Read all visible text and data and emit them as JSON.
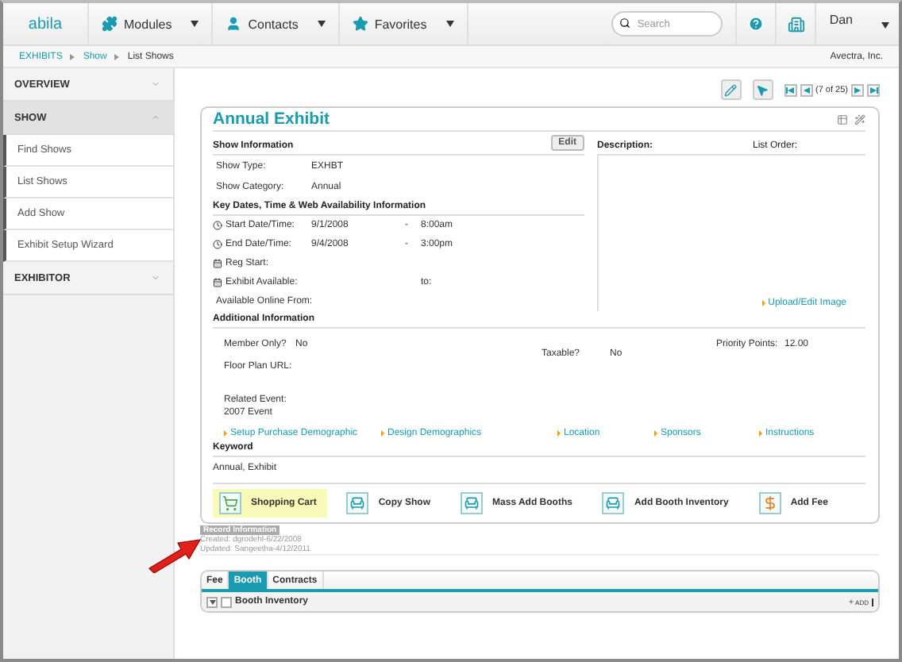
{
  "nav": {
    "logo": "abila",
    "menus": [
      {
        "kind": "modules",
        "label": "Modules"
      },
      {
        "kind": "contacts",
        "label": "Contacts"
      },
      {
        "kind": "favorites",
        "label": "Favorites"
      }
    ],
    "search": {
      "placeholder": "Search"
    },
    "user": "Dan"
  },
  "breadcrumb": {
    "items": [
      "EXHIBITS",
      "Show",
      "List Shows"
    ],
    "organization": "Avectra, Inc."
  },
  "sidebar": {
    "sections": [
      {
        "label": "OVERVIEW",
        "expanded": false
      },
      {
        "label": "SHOW",
        "expanded": true,
        "items": [
          "Find Shows",
          "List Shows",
          "Add Show",
          "Exhibit Setup Wizard"
        ]
      },
      {
        "label": "EXHIBITOR",
        "expanded": false
      }
    ]
  },
  "pager": {
    "position": "(7 of 25)"
  },
  "card": {
    "title": "Annual Exhibit",
    "show_information": {
      "heading": "Show Information",
      "edit_button": "Edit",
      "fields": [
        {
          "label": "Show Type:",
          "value": "EXHBT"
        },
        {
          "label": "Show Category:",
          "value": "Annual"
        }
      ]
    },
    "key_dates": {
      "heading": "Key Dates, Time & Web Availability Information",
      "rows": [
        {
          "kind": "time",
          "label": "Start Date/Time:",
          "date": "9/1/2008",
          "separator": "-",
          "time": "8:00am"
        },
        {
          "kind": "time",
          "label": "End Date/Time:",
          "date": "9/4/2008",
          "separator": "-",
          "time": "3:00pm"
        },
        {
          "kind": "date",
          "label": "Reg Start:"
        },
        {
          "kind": "date",
          "label": "Exhibit Available:",
          "to": "to:"
        },
        {
          "kind": "online",
          "label": "Available Online From:"
        }
      ]
    },
    "description": {
      "label": "Description:",
      "list_order": "List Order:",
      "upload_link": "Upload/Edit Image"
    },
    "additional": {
      "heading": "Additional Information",
      "member_only": {
        "label": "Member Only?",
        "value": "No"
      },
      "taxable": {
        "label": "Taxable?",
        "value": "No"
      },
      "priority_points": {
        "label": "Priority Points:",
        "value": "12.00"
      },
      "floor_plan_url": {
        "label": "Floor Plan URL:"
      },
      "related_event": {
        "label": "Related Event:",
        "value": "2007 Event"
      }
    },
    "links": [
      "Setup Purchase Demographic",
      "Design Demographics",
      "Location",
      "Sponsors",
      "Instructions"
    ],
    "keyword": {
      "heading": "Keyword",
      "value": "Annual, Exhibit"
    },
    "actions": [
      {
        "kind": "cart",
        "label": "Shopping Cart",
        "highlighted": true
      },
      {
        "kind": "booth",
        "label": "Copy Show",
        "highlighted": false
      },
      {
        "kind": "booth",
        "label": "Mass Add Booths",
        "highlighted": false
      },
      {
        "kind": "booth",
        "label": "Add Booth Inventory",
        "highlighted": false
      },
      {
        "kind": "fee",
        "label": "Add Fee",
        "highlighted": false
      }
    ]
  },
  "record_information": {
    "heading": "Record Information",
    "created": "Created: dgrodehl-6/22/2008",
    "updated": "Updated: Sangeetha-4/12/2011"
  },
  "tabs": [
    {
      "label": "Fee",
      "selected": false
    },
    {
      "label": "Booth",
      "selected": true
    },
    {
      "label": "Contracts",
      "selected": false
    }
  ],
  "grid": {
    "title": "Booth Inventory",
    "add": "ADD"
  }
}
